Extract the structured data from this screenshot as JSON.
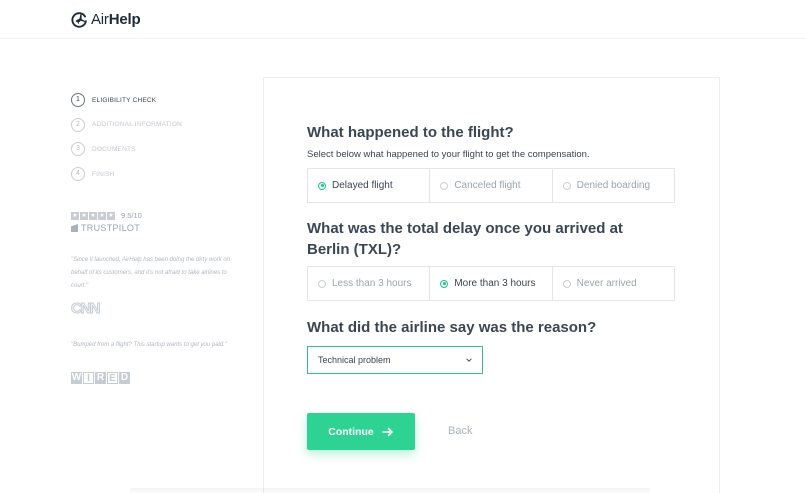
{
  "header": {
    "logo_prefix": "Air",
    "logo_suffix": "Help"
  },
  "steps": [
    {
      "number": "1",
      "label": "ELIGIBILITY CHECK",
      "active": true
    },
    {
      "number": "2",
      "label": "ADDITIONAL INFORMATION",
      "active": false
    },
    {
      "number": "3",
      "label": "DOCUMENTS",
      "active": false
    },
    {
      "number": "4",
      "label": "FINISH",
      "active": false
    }
  ],
  "rating": {
    "value": "9.5/10",
    "provider": "TRUSTPILOT",
    "stars": 5
  },
  "quotes": [
    {
      "text": "\"Since it launched, AirHelp has been doing the dirty work on behalf of its customers, and it's not afraid to take airlines to court.\"",
      "source": "CNN"
    },
    {
      "text": "\"Bumped from a flight? This startup wants to get you paid.\"",
      "source": "WIRED"
    }
  ],
  "form": {
    "q1": {
      "title": "What happened to the flight?",
      "subtitle": "Select below what happened to your flight to get the compensation.",
      "options": [
        "Delayed flight",
        "Canceled flight",
        "Denied boarding"
      ],
      "selected": "Delayed flight"
    },
    "q2": {
      "title": "What was the total delay once you arrived at Berlin (TXL)?",
      "options": [
        "Less than 3 hours",
        "More than 3 hours",
        "Never arrived"
      ],
      "selected": "More than 3 hours"
    },
    "q3": {
      "title": "What did the airline say was the reason?",
      "select_value": "Technical problem"
    },
    "continue_label": "Continue",
    "back_label": "Back"
  },
  "colors": {
    "accent": "#2ed394",
    "text": "#3b4450",
    "muted": "#9aa3ad"
  }
}
